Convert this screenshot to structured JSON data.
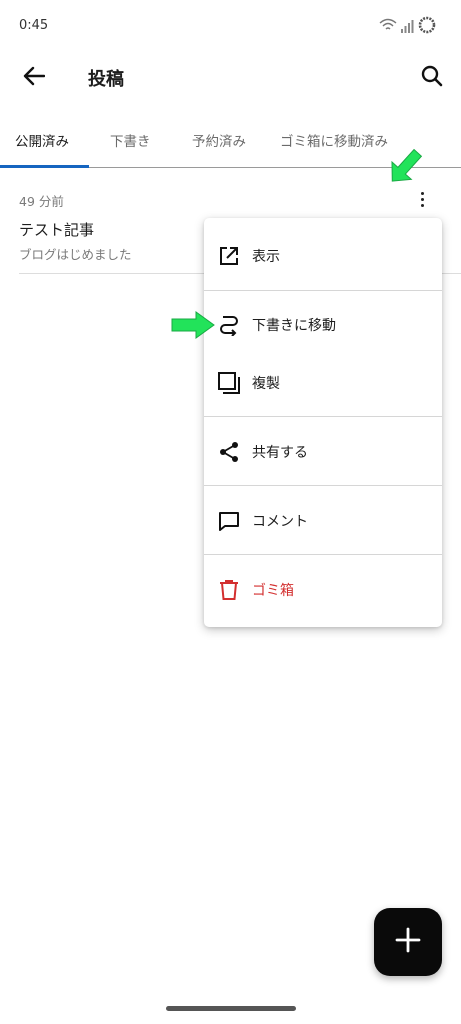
{
  "status_bar": {
    "time": "0:45",
    "icons": [
      "wifi-icon",
      "signal-icon",
      "battery-icon"
    ]
  },
  "app_bar": {
    "title": "投稿",
    "back_icon": "arrow-left-icon",
    "search_icon": "search-icon"
  },
  "tabs": [
    {
      "label": "公開済み",
      "active": true
    },
    {
      "label": "下書き",
      "active": false
    },
    {
      "label": "予約済み",
      "active": false
    },
    {
      "label": "ゴミ箱に移動済み",
      "active": false
    }
  ],
  "post": {
    "time": "49 分前",
    "title": "テスト記事",
    "excerpt": "ブログはじめました",
    "more_icon": "more-vertical-icon"
  },
  "menu": {
    "items": [
      {
        "label": "表示",
        "icon": "external-link-icon"
      },
      {
        "label": "下書きに移動",
        "icon": "move-to-draft-icon"
      },
      {
        "label": "複製",
        "icon": "duplicate-icon"
      },
      {
        "label": "共有する",
        "icon": "share-icon"
      },
      {
        "label": "コメント",
        "icon": "comment-icon"
      },
      {
        "label": "ゴミ箱",
        "icon": "trash-icon"
      }
    ]
  },
  "fab": {
    "icon": "plus-icon"
  },
  "colors": {
    "accent": "#1565c0",
    "danger": "#d32f2f",
    "annotation_arrow": "#22e35a",
    "fab_bg": "#0a0a0a"
  }
}
